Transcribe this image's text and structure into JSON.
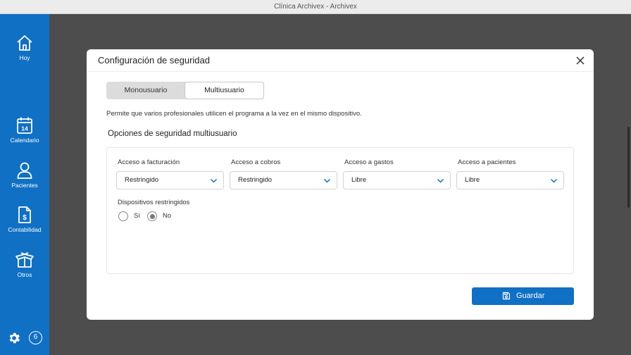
{
  "window": {
    "title": "Clínica Archivex - Archivex"
  },
  "sidebar": {
    "items": [
      {
        "label": "Hoy",
        "icon": "home-icon"
      },
      {
        "label": "Calendario",
        "icon": "calendar-icon",
        "day": "14"
      },
      {
        "label": "Pacientes",
        "icon": "user-icon"
      },
      {
        "label": "Contabilidad",
        "icon": "invoice-icon"
      },
      {
        "label": "Otros",
        "icon": "box-icon"
      }
    ],
    "settings_icon": "gear-icon",
    "badge_count": "6"
  },
  "dialog": {
    "title": "Configuración de seguridad",
    "close_icon": "close-icon",
    "mode_tabs": [
      {
        "label": "Monousuario",
        "selected": false
      },
      {
        "label": "Multiusuario",
        "selected": true
      }
    ],
    "description": "Permite que varios profesionales utilicen el programa a la vez en el mismo dispositivo.",
    "section_title": "Opciones de seguridad multiusuario",
    "fields": [
      {
        "label": "Acceso a facturación",
        "value": "Restringido"
      },
      {
        "label": "Acceso a cobros",
        "value": "Restringido"
      },
      {
        "label": "Acceso a gastos",
        "value": "Libre"
      },
      {
        "label": "Acceso a pacientes",
        "value": "Libre"
      }
    ],
    "restricted_devices": {
      "label": "Dispositivos restringidos",
      "options": [
        {
          "label": "Sí",
          "checked": false
        },
        {
          "label": "No",
          "checked": true
        }
      ]
    },
    "save_label": "Guardar"
  },
  "colors": {
    "accent": "#1070c4",
    "backdrop": "#4d4d4d"
  }
}
